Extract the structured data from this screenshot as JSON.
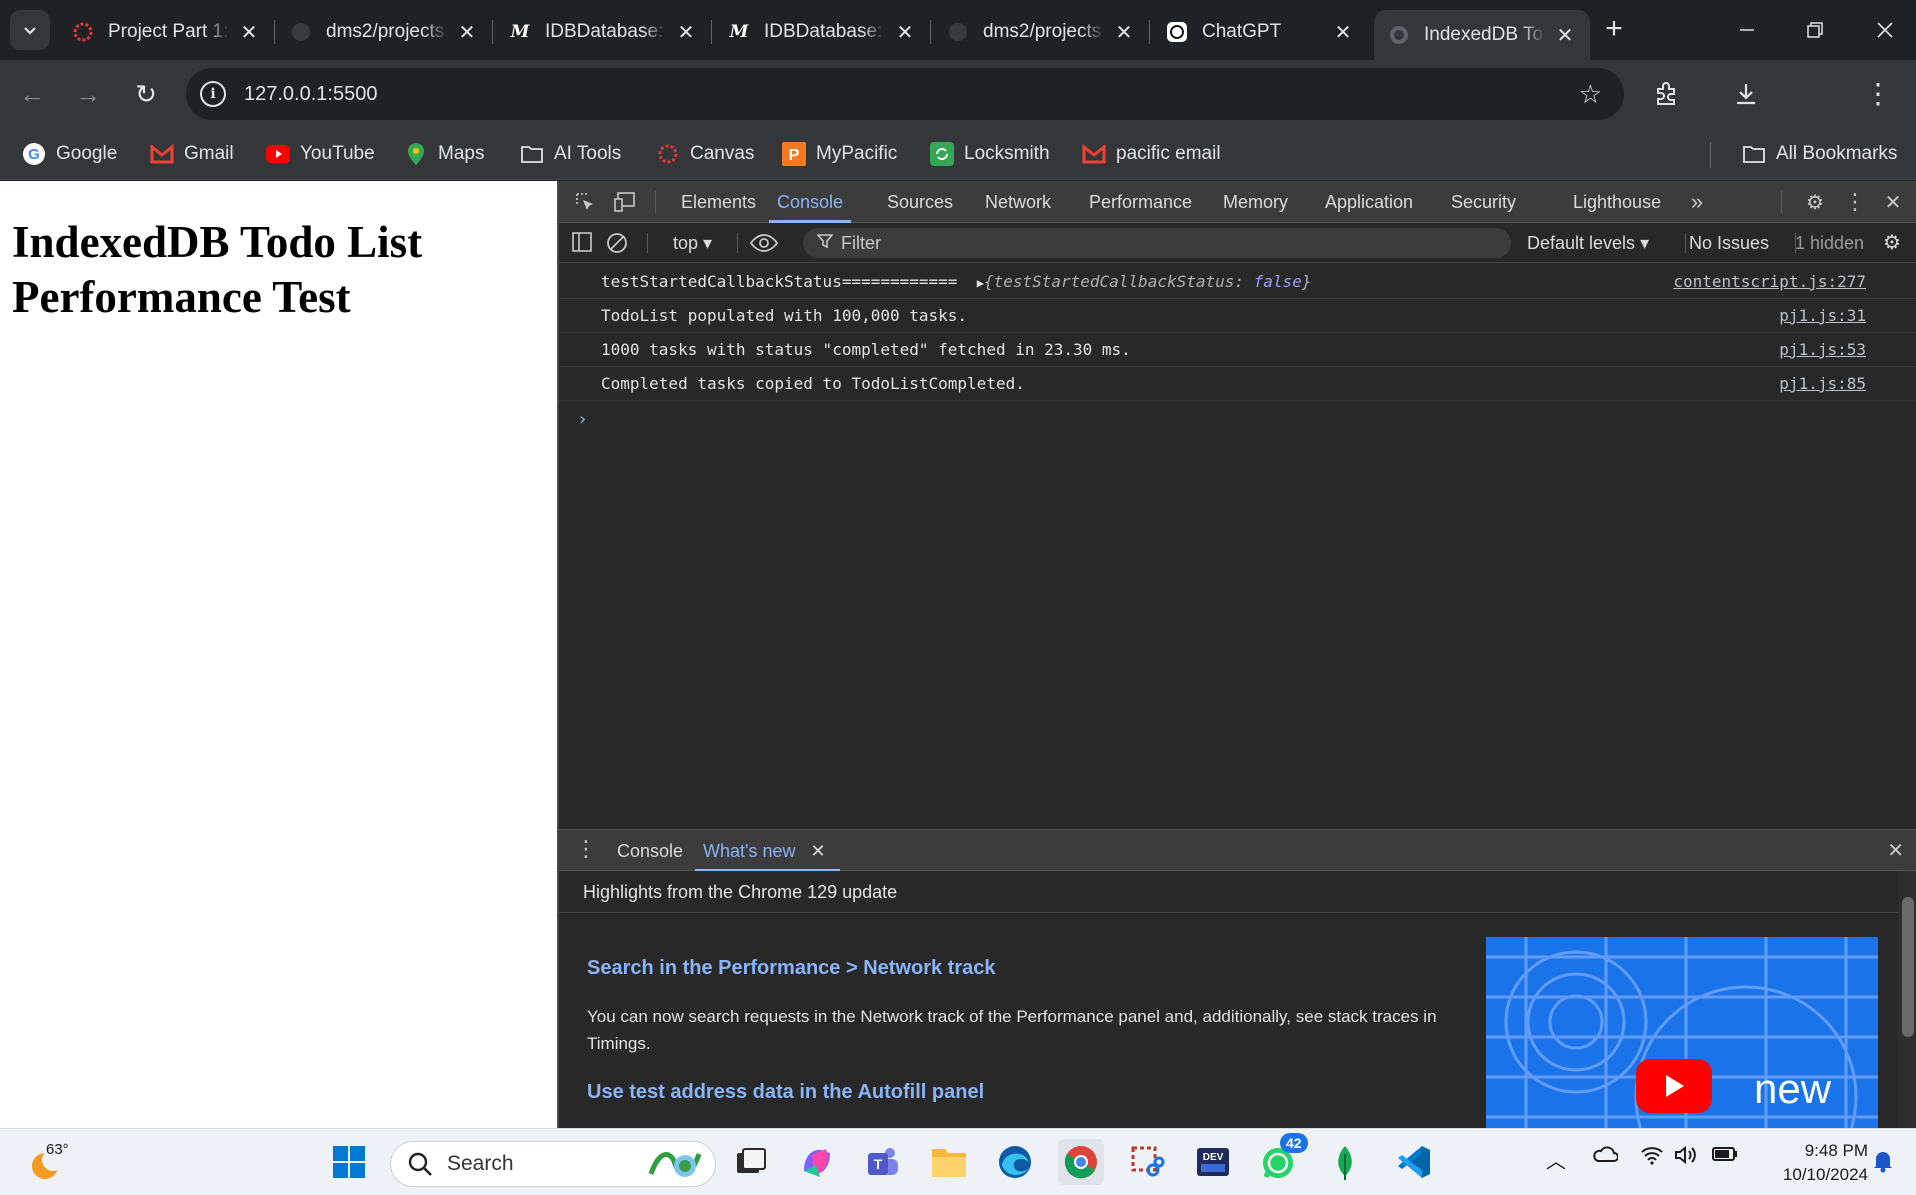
{
  "tabs": [
    {
      "title": "Project Part 1:",
      "icon": "pacific-icon"
    },
    {
      "title": "dms2/projects",
      "icon": "github-icon"
    },
    {
      "title": "IDBDatabase:",
      "icon": "mdn-icon"
    },
    {
      "title": "IDBDatabase:",
      "icon": "mdn-icon"
    },
    {
      "title": "dms2/projects",
      "icon": "github-icon"
    },
    {
      "title": "ChatGPT",
      "icon": "chatgpt-icon"
    },
    {
      "title": "IndexedDB To",
      "icon": "globe-icon",
      "active": true
    }
  ],
  "address": {
    "url": "127.0.0.1:5500"
  },
  "bookmarks": [
    {
      "label": "Google",
      "icon": "google-icon"
    },
    {
      "label": "Gmail",
      "icon": "gmail-icon"
    },
    {
      "label": "YouTube",
      "icon": "youtube-icon"
    },
    {
      "label": "Maps",
      "icon": "maps-icon"
    },
    {
      "label": "AI Tools",
      "icon": "folder-icon"
    },
    {
      "label": "Canvas",
      "icon": "canvas-icon"
    },
    {
      "label": "MyPacific",
      "icon": "pacific-p-icon"
    },
    {
      "label": "Locksmith",
      "icon": "locksmith-icon"
    },
    {
      "label": "pacific email",
      "icon": "gmail-icon"
    }
  ],
  "all_bookmarks": "All Bookmarks",
  "page": {
    "heading": "IndexedDB Todo List Performance Test"
  },
  "devtools": {
    "tabs": [
      "Elements",
      "Console",
      "Sources",
      "Network",
      "Performance",
      "Memory",
      "Application",
      "Security",
      "Lighthouse"
    ],
    "active_tab": "Console",
    "context": "top",
    "filter_placeholder": "Filter",
    "levels": "Default levels",
    "issues": "No Issues",
    "hidden": "1 hidden",
    "console_rows": [
      {
        "msg_prefix": "testStartedCallbackStatus============",
        "obj_key": "testStartedCallbackStatus",
        "obj_val": "false",
        "source": "contentscript.js:277"
      },
      {
        "msg": "TodoList populated with 100,000 tasks.",
        "source": "pj1.js:31"
      },
      {
        "msg": "1000 tasks with status \"completed\" fetched in 23.30 ms.",
        "source": "pj1.js:53"
      },
      {
        "msg": "Completed tasks copied to TodoListCompleted.",
        "source": "pj1.js:85"
      }
    ],
    "drawer": {
      "tabs": [
        "Console",
        "What's new"
      ],
      "active_tab": "What's new",
      "header": "Highlights from the Chrome 129 update",
      "items": [
        {
          "title": "Search in the Performance > Network track",
          "body": "You can now search requests in the Network track of the Performance panel and, additionally, see stack traces in Timings."
        },
        {
          "title": "Use test address data in the Autofill panel"
        }
      ],
      "video_badge": "new"
    }
  },
  "taskbar": {
    "weather": "63°",
    "search_placeholder": "Search",
    "whatsapp_badge": "42",
    "time": "9:48 PM",
    "date": "10/10/2024"
  },
  "colors": {
    "accent": "#8ab4f8",
    "page_bg": "#ffffff",
    "devtools_bg": "#282828"
  }
}
